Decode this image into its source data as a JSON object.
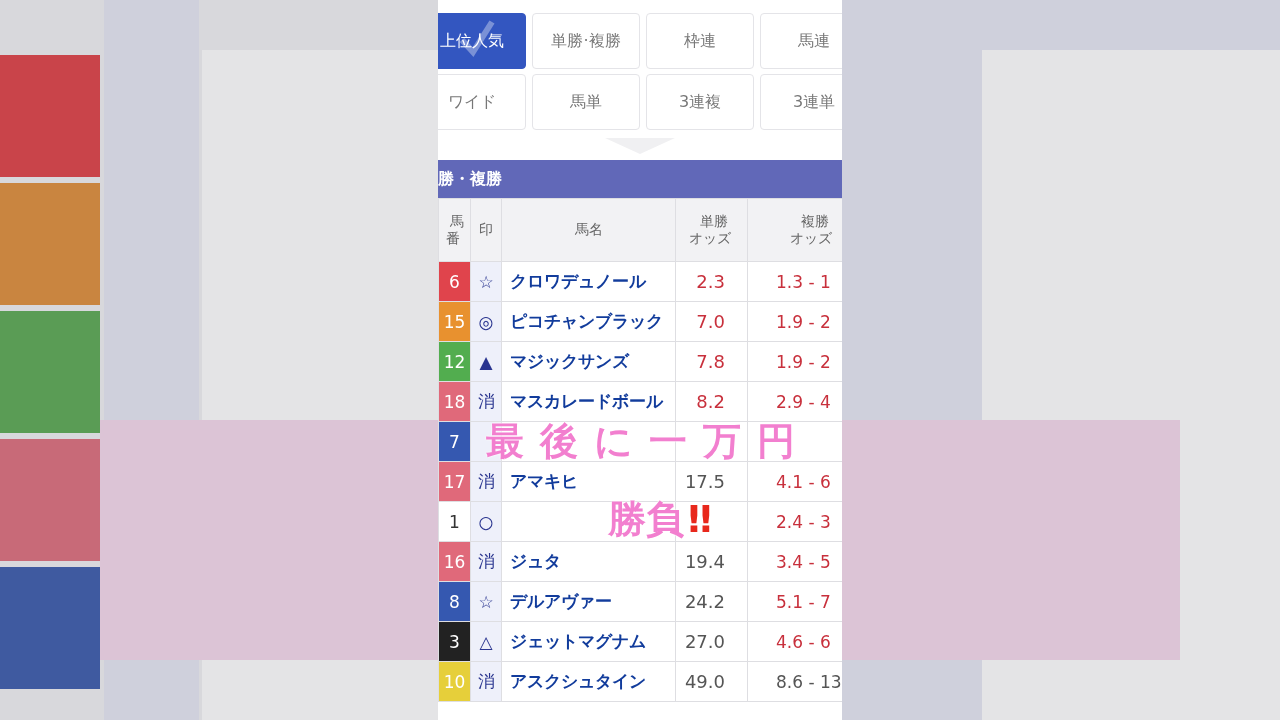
{
  "bet_tabs": [
    {
      "label": "上位人気",
      "selected": true
    },
    {
      "label": "単勝·複勝",
      "selected": false
    },
    {
      "label": "枠連",
      "selected": false
    },
    {
      "label": "馬連",
      "selected": false
    },
    {
      "label": "ワイド",
      "selected": false
    },
    {
      "label": "馬単",
      "selected": false
    },
    {
      "label": "3連複",
      "selected": false
    },
    {
      "label": "3連単",
      "selected": false
    }
  ],
  "section_title": "勝・複勝",
  "table": {
    "columns": [
      "馬番",
      "印",
      "馬名",
      "単勝オッズ",
      "複勝オッズ"
    ],
    "rows": [
      {
        "number": "6",
        "color": "#e0444c",
        "mark": "☆",
        "name": "クロワデュノール",
        "win": "2.3",
        "win_hot": true,
        "place": "1.3 - 1",
        "place_hot": true
      },
      {
        "number": "15",
        "color": "#e8912f",
        "mark": "◎",
        "name": "ピコチャンブラック",
        "win": "7.0",
        "win_hot": true,
        "place": "1.9 - 2",
        "place_hot": true
      },
      {
        "number": "12",
        "color": "#52ad4f",
        "mark": "▲",
        "name": "マジックサンズ",
        "win": "7.8",
        "win_hot": true,
        "place": "1.9 - 2",
        "place_hot": true
      },
      {
        "number": "18",
        "color": "#e0697a",
        "mark": "消",
        "name": "マスカレードボール",
        "win": "8.2",
        "win_hot": true,
        "place": "2.9 - 4",
        "place_hot": true
      },
      {
        "number": "7",
        "color": "#3558b0"
      },
      {
        "number": "17",
        "color": "#e0697a",
        "mark": "消",
        "name": "アマキヒ",
        "win": "17.5",
        "win_hot": false,
        "place": "4.1 - 6",
        "place_hot": true
      },
      {
        "number": "1",
        "color": "#ffffff",
        "mark": "○",
        "place": "2.4 - 3",
        "place_hot": true
      },
      {
        "number": "16",
        "color": "#e0697a",
        "mark": "消",
        "name": "ジュタ",
        "win": "19.4",
        "win_hot": false,
        "place": "3.4 - 5",
        "place_hot": true
      },
      {
        "number": "8",
        "color": "#3558b0",
        "mark": "☆",
        "name": "デルアヴァー",
        "win": "24.2",
        "win_hot": false,
        "place": "5.1 - 7",
        "place_hot": true
      },
      {
        "number": "3",
        "color": "#222222",
        "mark": "△",
        "name": "ジェットマグナム",
        "win": "27.0",
        "win_hot": false,
        "place": "4.6 - 6",
        "place_hot": true
      },
      {
        "number": "10",
        "color": "#e6cf3a",
        "mark": "消",
        "name": "アスクシュタイン",
        "win": "49.0",
        "win_hot": false,
        "place": "8.6 - 13",
        "place_hot": false
      }
    ]
  },
  "caption": {
    "line1": "最後に一万円",
    "line2": "勝負",
    "emphasis": "‼"
  }
}
